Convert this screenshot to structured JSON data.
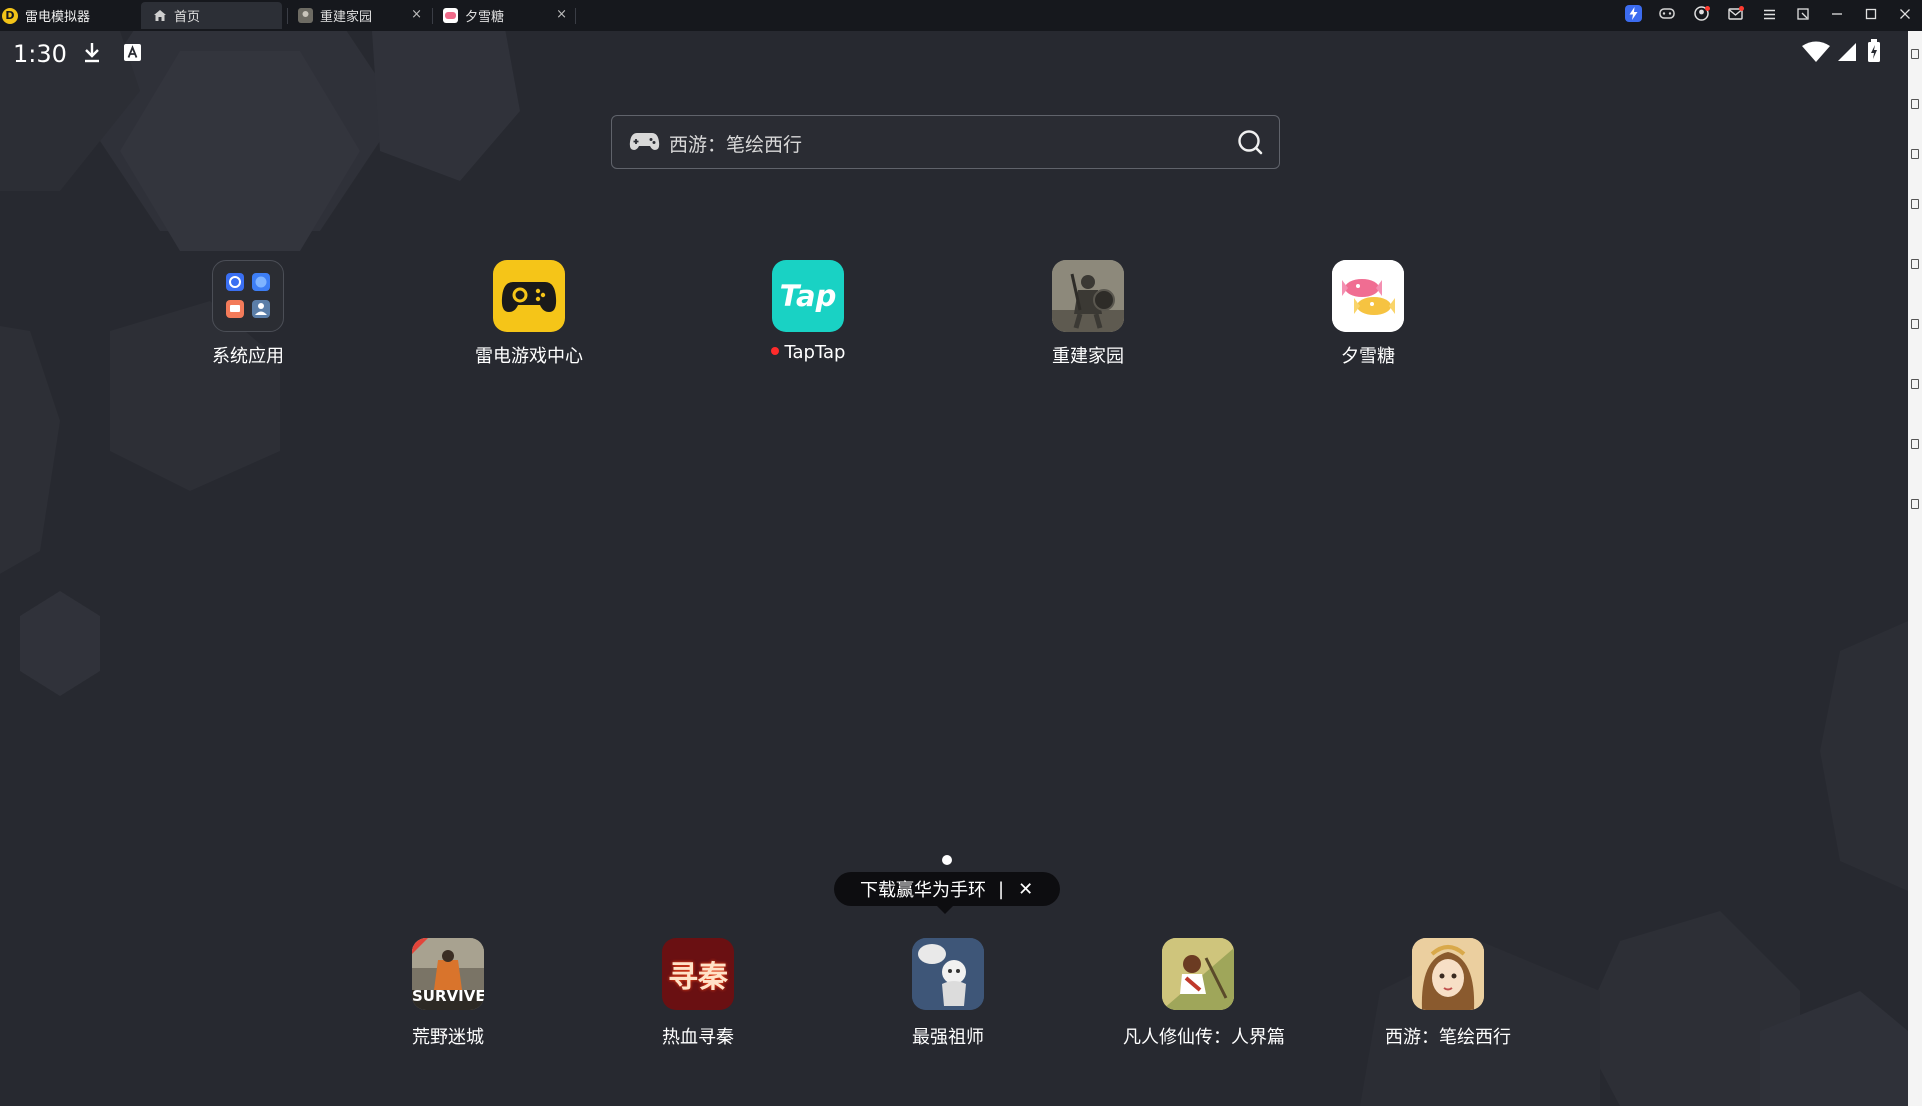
{
  "titlebar": {
    "app_name": "雷电模拟器",
    "tabs": [
      {
        "label": "首页",
        "icon": "home-icon",
        "active": true
      },
      {
        "label": "重建家园",
        "icon": "game-thumbnail-icon",
        "active": false,
        "close": "×"
      },
      {
        "label": "夕雪糖",
        "icon": "game-thumbnail-icon",
        "active": false,
        "close": "×"
      }
    ]
  },
  "status_bar": {
    "time": "1:30"
  },
  "search": {
    "text": "西游：笔绘西行"
  },
  "apps": [
    {
      "label": "系统应用",
      "icon": "folder-icon"
    },
    {
      "label": "雷电游戏中心",
      "icon": "gamepad-icon"
    },
    {
      "label": "TapTap",
      "icon": "taptap-icon",
      "new": true
    },
    {
      "label": "重建家园",
      "icon": "warrior-icon"
    },
    {
      "label": "夕雪糖",
      "icon": "candy-icon"
    }
  ],
  "taptap_logo": "Tap",
  "dock": [
    {
      "label": "荒野迷城",
      "icon_text": "SURVIVE"
    },
    {
      "label": "热血寻秦",
      "icon_text": "寻秦"
    },
    {
      "label": "最强祖师",
      "icon_text": ""
    },
    {
      "label": "凡人修仙传：人界篇",
      "icon_text": ""
    },
    {
      "label": "西游：笔绘西行",
      "icon_text": ""
    }
  ],
  "tooltip": {
    "text": "下载赢华为手环",
    "separator": "|",
    "close": "✕"
  },
  "colors": {
    "screen_bg": "#272930",
    "titlebar_bg": "#16181d",
    "gamecenter_yellow": "#f5c518",
    "taptap_teal": "#19d2c4"
  }
}
